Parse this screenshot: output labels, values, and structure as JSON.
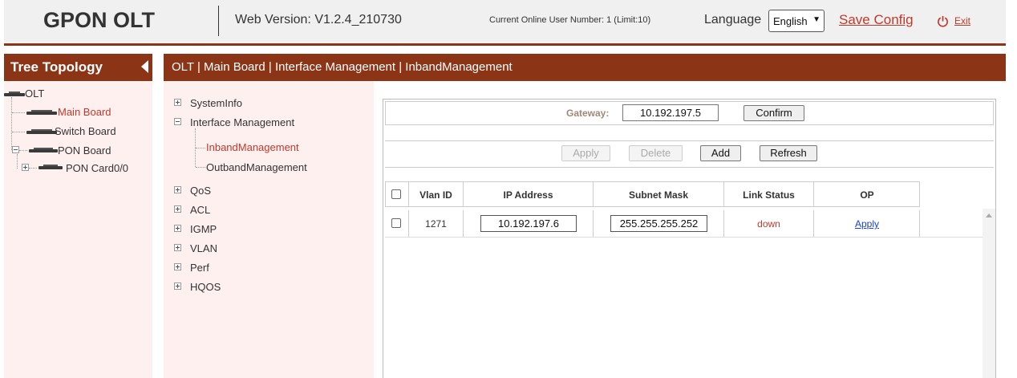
{
  "header": {
    "logo": "GPON OLT",
    "web_version": "Web Version: V1.2.4_210730",
    "online_users": "Current Online User Number: 1 (Limit:10)",
    "language_label": "Language",
    "language_value": "English",
    "save_config": "Save Config",
    "exit": "Exit"
  },
  "tree": {
    "title": "Tree Topology",
    "items": [
      {
        "label": "OLT"
      },
      {
        "label": "Main Board"
      },
      {
        "label": "Switch Board"
      },
      {
        "label": "PON Board"
      },
      {
        "label": "PON Card0/0"
      }
    ]
  },
  "breadcrumb": "OLT | Main Board | Interface Management | InbandManagement",
  "menu": {
    "items": [
      {
        "label": "SystemInfo"
      },
      {
        "label": "Interface Management"
      },
      {
        "label": "InbandManagement"
      },
      {
        "label": "OutbandManagement"
      },
      {
        "label": "QoS"
      },
      {
        "label": "ACL"
      },
      {
        "label": "IGMP"
      },
      {
        "label": "VLAN"
      },
      {
        "label": "Perf"
      },
      {
        "label": "HQOS"
      }
    ]
  },
  "gateway": {
    "label": "Gateway:",
    "value": "10.192.197.5",
    "confirm": "Confirm"
  },
  "toolbar": {
    "apply": "Apply",
    "delete": "Delete",
    "add": "Add",
    "refresh": "Refresh"
  },
  "table": {
    "columns": [
      "Vlan ID",
      "IP Address",
      "Subnet Mask",
      "Link Status",
      "OP"
    ],
    "rows": [
      {
        "vlan_id": "1271",
        "ip": "10.192.197.6",
        "mask": "255.255.255.252",
        "status": "down",
        "op": "Apply"
      }
    ]
  },
  "colors": {
    "accent": "#8b3416",
    "link_red": "#c0392b",
    "panel_bg": "#fff0f0"
  }
}
